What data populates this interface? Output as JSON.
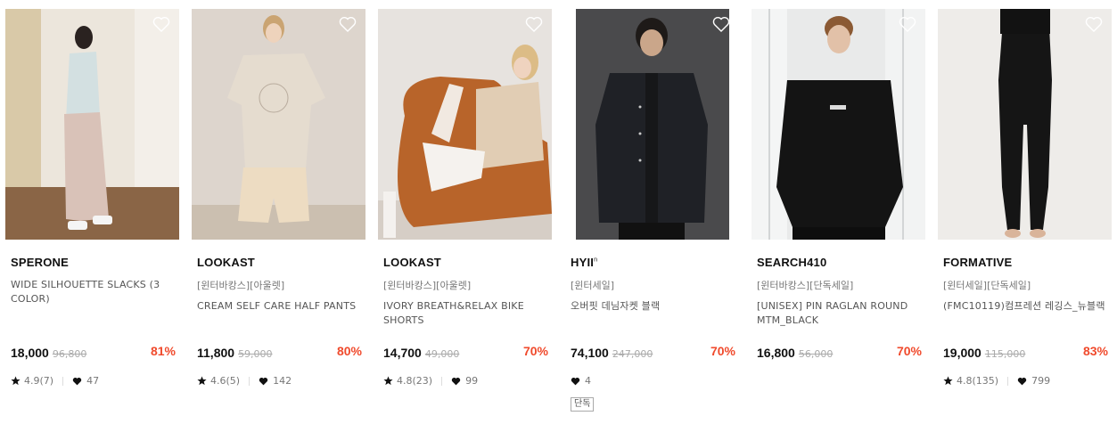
{
  "products": [
    {
      "brand": "SPERONE",
      "tags": "",
      "name": "WIDE SILHOUETTE SLACKS (3 COLOR)",
      "price": "18,000",
      "original_price": "96,800",
      "discount": "81%",
      "rating": "4.9(7)",
      "likes": "47",
      "badge": ""
    },
    {
      "brand": "LOOKAST",
      "tags": "[윈터바캉스][아울렛]",
      "name": "CREAM SELF CARE HALF PANTS",
      "price": "11,800",
      "original_price": "59,000",
      "discount": "80%",
      "rating": "4.6(5)",
      "likes": "142",
      "badge": ""
    },
    {
      "brand": "LOOKAST",
      "tags": "[윈터바캉스][아울렛]",
      "name": "IVORY BREATH&RELAX BIKE SHORTS",
      "price": "14,700",
      "original_price": "49,000",
      "discount": "70%",
      "rating": "4.8(23)",
      "likes": "99",
      "badge": ""
    },
    {
      "brand": "HYII",
      "brand_sup": "n",
      "tags": "[윈터세일]",
      "name": "오버핏 데님자켓 블랙",
      "price": "74,100",
      "original_price": "247,000",
      "discount": "70%",
      "rating": "",
      "likes": "4",
      "badge": "단독"
    },
    {
      "brand": "SEARCH410",
      "tags": "[윈터바캉스][단독세일]",
      "name": "[UNISEX] PIN RAGLAN ROUND MTM_BLACK",
      "price": "16,800",
      "original_price": "56,000",
      "discount": "70%",
      "rating": "",
      "likes": "",
      "badge": ""
    },
    {
      "brand": "FORMATIVE",
      "tags": "[윈터세일][단독세일]",
      "name": "(FMC10119)컴프레션 레깅스_뉴블랙",
      "price": "19,000",
      "original_price": "115,000",
      "discount": "83%",
      "rating": "4.8(135)",
      "likes": "799",
      "badge": ""
    }
  ],
  "colors": {
    "discount": "#f04a2c",
    "price": "#111111",
    "muted": "#777777"
  }
}
